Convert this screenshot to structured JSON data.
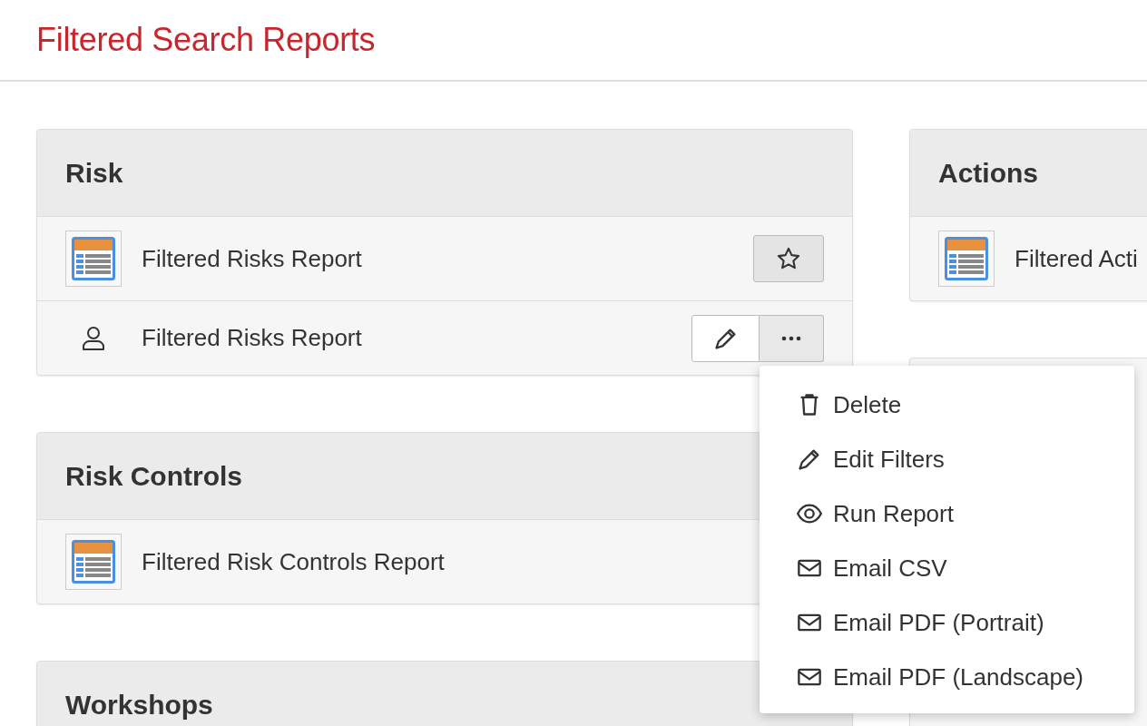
{
  "page_title": "Filtered Search Reports",
  "columns": [
    [
      {
        "title": "Risk",
        "rows": [
          {
            "kind": "report",
            "label": "Filtered Risks Report"
          },
          {
            "kind": "user",
            "label": "Filtered Risks Report"
          }
        ]
      },
      {
        "title": "Risk Controls",
        "rows": [
          {
            "kind": "plain",
            "label": "Filtered Risk Controls Report"
          }
        ]
      },
      {
        "title": "Workshops"
      }
    ],
    [
      {
        "title": "Actions",
        "rows": [
          {
            "kind": "plain",
            "label": "Filtered Acti"
          }
        ]
      },
      {
        "kind": "hidden"
      }
    ]
  ],
  "menu": [
    {
      "kind": "delete",
      "label": "Delete"
    },
    {
      "kind": "edit",
      "label": "Edit Filters"
    },
    {
      "kind": "view",
      "label": "Run Report"
    },
    {
      "kind": "email",
      "label": "Email CSV"
    },
    {
      "kind": "email",
      "label": "Email PDF (Portrait)"
    },
    {
      "kind": "email",
      "label": "Email PDF (Landscape)"
    }
  ]
}
